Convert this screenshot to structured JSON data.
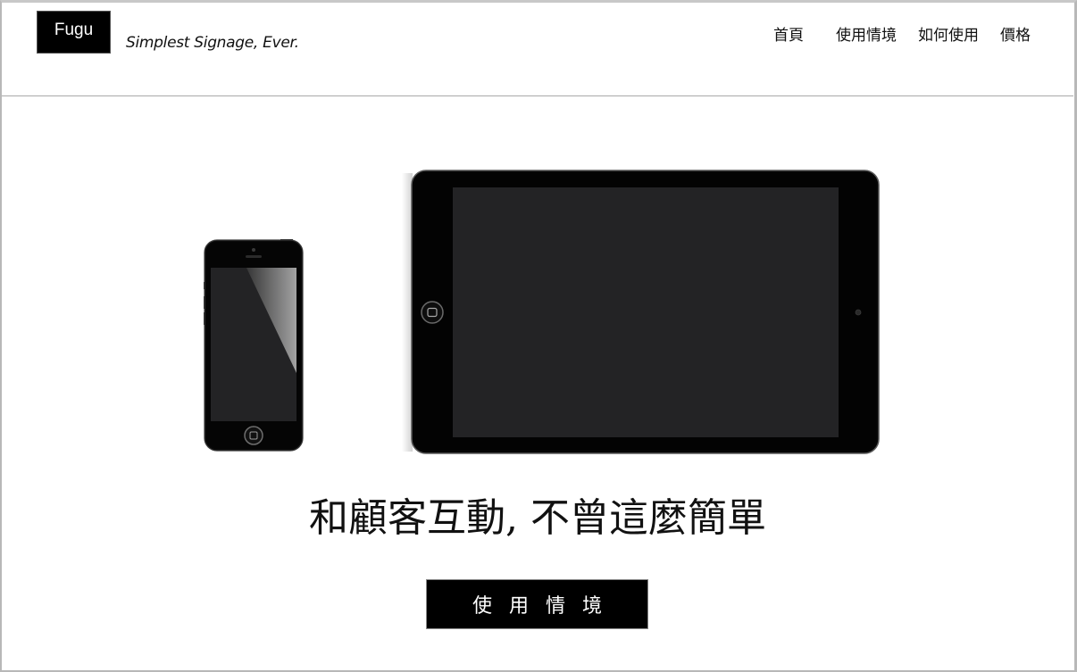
{
  "header": {
    "logo_text": "Fugu",
    "tagline": "Simplest Signage, Ever.",
    "nav": [
      {
        "label": "首頁"
      },
      {
        "label": "使用情境"
      },
      {
        "label": "如何使用"
      },
      {
        "label": "價格"
      }
    ]
  },
  "hero": {
    "headline": "和顧客互動, 不曾這麼簡單",
    "cta_label": "使用情境",
    "devices": [
      {
        "icon": "smartphone-icon"
      },
      {
        "icon": "tablet-icon"
      }
    ]
  },
  "colors": {
    "background": "#ffffff",
    "text": "#111111",
    "button_bg": "#000000",
    "button_text": "#ffffff",
    "device_body": "#050505",
    "device_screen": "#232325"
  }
}
